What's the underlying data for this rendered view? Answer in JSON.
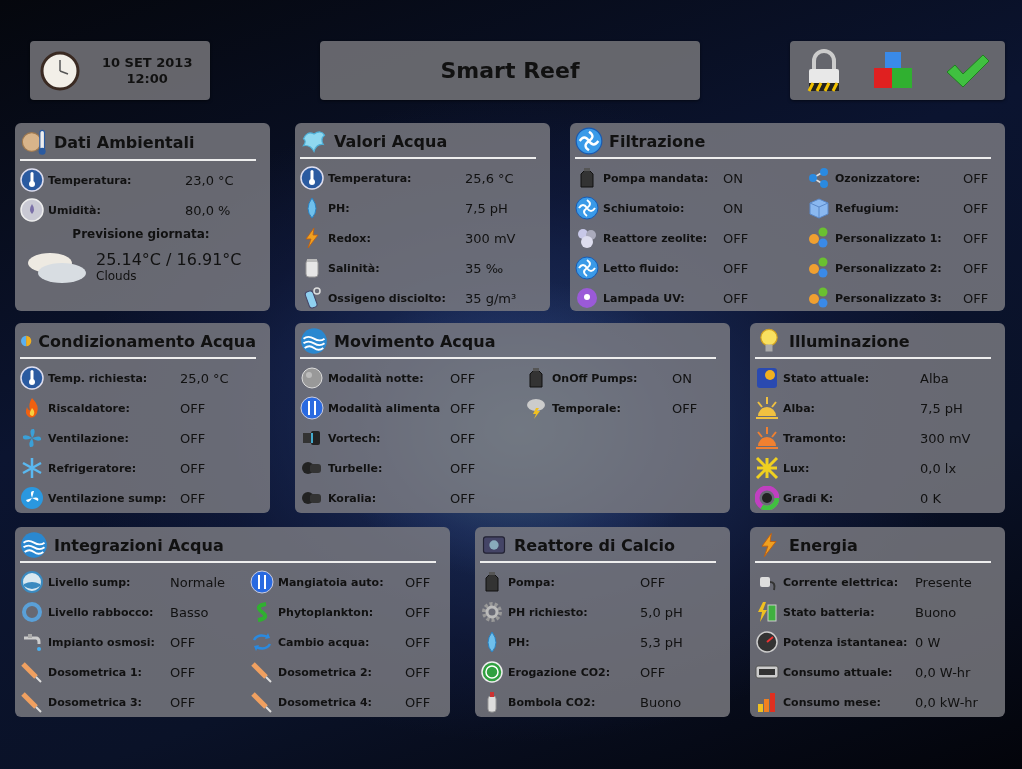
{
  "header": {
    "date": "10 SET 2013",
    "time": "12:00",
    "title": "Smart Reef"
  },
  "panel_rows": [
    [
      {
        "title": "Dati Ambientali",
        "columns": [
          [
            {
              "label": "Temperatura:",
              "value": "23,0 °C"
            },
            {
              "label": "Umidità:",
              "value": "80,0 %"
            }
          ]
        ],
        "forecast": {
          "heading": "Previsione giornata:",
          "temperatures": "25.14°C / 16.91°C",
          "condition": "Clouds"
        }
      },
      {
        "title": "Valori Acqua",
        "columns": [
          [
            {
              "label": "Temperatura:",
              "value": "25,6 °C"
            },
            {
              "label": "PH:",
              "value": "7,5 pH"
            },
            {
              "label": "Redox:",
              "value": "300 mV"
            },
            {
              "label": "Salinità:",
              "value": "35 ‰"
            },
            {
              "label": "Ossigeno disciolto:",
              "value": "35 g/m³"
            }
          ]
        ]
      },
      {
        "title": "Filtrazione",
        "columns": [
          [
            {
              "label": "Pompa mandata:",
              "value": "ON"
            },
            {
              "label": "Schiumatoio:",
              "value": "ON"
            },
            {
              "label": "Reattore zeolite:",
              "value": "OFF"
            },
            {
              "label": "Letto fluido:",
              "value": "OFF"
            },
            {
              "label": "Lampada UV:",
              "value": "OFF"
            }
          ],
          [
            {
              "label": "Ozonizzatore:",
              "value": "OFF"
            },
            {
              "label": "Refugium:",
              "value": "OFF"
            },
            {
              "label": "Personalizzato 1:",
              "value": "OFF"
            },
            {
              "label": "Personalizzato 2:",
              "value": "OFF"
            },
            {
              "label": "Personalizzato 3:",
              "value": "OFF"
            }
          ]
        ]
      }
    ],
    [
      {
        "title": "Condizionamento Acqua",
        "columns": [
          [
            {
              "label": "Temp. richiesta:",
              "value": "25,0 °C"
            },
            {
              "label": "Riscaldatore:",
              "value": "OFF"
            },
            {
              "label": "Ventilazione:",
              "value": "OFF"
            },
            {
              "label": "Refrigeratore:",
              "value": "OFF"
            },
            {
              "label": "Ventilazione sump:",
              "value": "OFF"
            }
          ]
        ]
      },
      {
        "title": "Movimento Acqua",
        "columns": [
          [
            {
              "label": "Modalità notte:",
              "value": "OFF"
            },
            {
              "label": "Modalità alimenta",
              "value": "OFF"
            },
            {
              "label": "Vortech:",
              "value": "OFF"
            },
            {
              "label": "Turbelle:",
              "value": "OFF"
            },
            {
              "label": "Koralia:",
              "value": "OFF"
            }
          ],
          [
            {
              "label": "OnOff Pumps:",
              "value": "ON"
            },
            {
              "label": "Temporale:",
              "value": "OFF"
            }
          ]
        ]
      },
      {
        "title": "Illuminazione",
        "columns": [
          [
            {
              "label": "Stato attuale:",
              "value": "Alba"
            },
            {
              "label": "Alba:",
              "value": "7,5 pH"
            },
            {
              "label": "Tramonto:",
              "value": "300 mV"
            },
            {
              "label": "Lux:",
              "value": "0,0 lx"
            },
            {
              "label": "Gradi K:",
              "value": "0 K"
            }
          ]
        ]
      }
    ],
    [
      {
        "title": "Integrazioni Acqua",
        "columns": [
          [
            {
              "label": "Livello sump:",
              "value": "Normale"
            },
            {
              "label": "Livello rabbocco:",
              "value": "Basso"
            },
            {
              "label": "Impianto osmosi:",
              "value": "OFF"
            },
            {
              "label": "Dosometrica 1:",
              "value": "OFF"
            },
            {
              "label": "Dosometrica 3:",
              "value": "OFF"
            }
          ],
          [
            {
              "label": "Mangiatoia auto:",
              "value": "OFF"
            },
            {
              "label": "Phytoplankton:",
              "value": "OFF"
            },
            {
              "label": "Cambio acqua:",
              "value": "OFF"
            },
            {
              "label": "Dosometrica 2:",
              "value": "OFF"
            },
            {
              "label": "Dosometrica 4:",
              "value": "OFF"
            }
          ]
        ]
      },
      {
        "title": "Reattore di Calcio",
        "columns": [
          [
            {
              "label": "Pompa:",
              "value": "OFF"
            },
            {
              "label": "PH richiesto:",
              "value": "5,0 pH"
            },
            {
              "label": "PH:",
              "value": "5,3 pH"
            },
            {
              "label": "Erogazione CO2:",
              "value": "OFF"
            },
            {
              "label": "Bombola CO2:",
              "value": "Buono"
            }
          ]
        ]
      },
      {
        "title": "Energia",
        "columns": [
          [
            {
              "label": "Corrente elettrica:",
              "value": "Presente"
            },
            {
              "label": "Stato batteria:",
              "value": "Buono"
            },
            {
              "label": "Potenza istantanea:",
              "value": "0 W"
            },
            {
              "label": "Consumo attuale:",
              "value": "0,0 W-hr"
            },
            {
              "label": "Consumo mese:",
              "value": "0,0 kW-hr"
            }
          ]
        ]
      }
    ]
  ]
}
